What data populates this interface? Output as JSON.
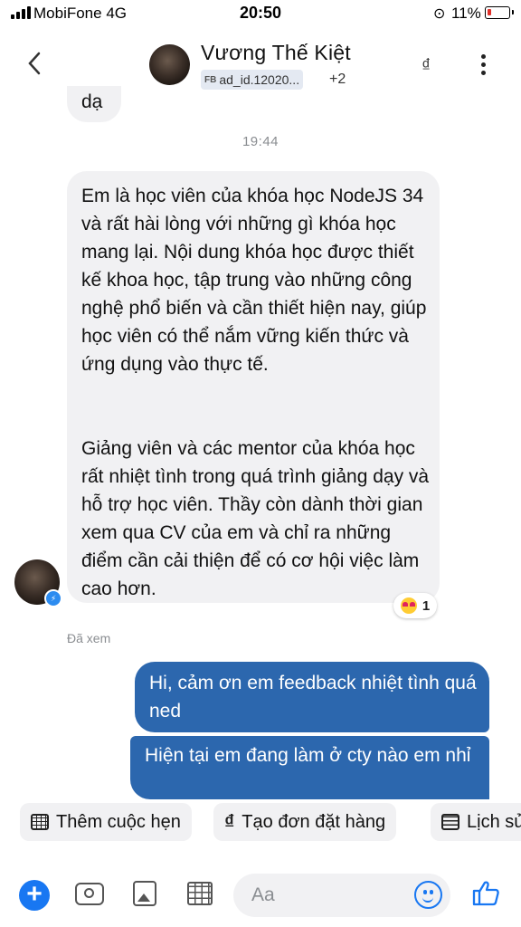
{
  "status_bar": {
    "carrier": "MobiFone  4G",
    "time": "20:50",
    "battery_percent": "11%"
  },
  "header": {
    "back_icon": "chevron-left-icon",
    "name": "Vương Thế Kiệt",
    "tag_prefix": "FB",
    "tag": "ad_id.12020...",
    "tag_more": "+2",
    "currency_icon": "₫",
    "more_icon": "vertical-ellipsis-icon"
  },
  "conversation": {
    "previous_message": "dạ",
    "timestamp": "19:44",
    "incoming": {
      "paragraph1": "Em là học viên của khóa học NodeJS 34 và rất hài lòng với những gì khóa học mang lại. Nội dung khóa học được thiết kế khoa học, tập trung vào những công nghệ phổ biến và cần thiết hiện nay, giúp học viên có thể nắm vững kiến thức và ứng dụng vào thực tế.",
      "paragraph2": "Giảng viên và các mentor của khóa học rất nhiệt tình trong quá trình giảng dạy và hỗ trợ học viên. Thầy còn dành thời gian xem qua CV của em và chỉ ra những điểm cần cải thiện để có cơ hội việc làm cao hơn.",
      "reaction_count": "1"
    },
    "seen_label": "Đã xem",
    "outgoing": [
      "Hi, cảm ơn em feedback nhiệt tình quá ned",
      "Hiện tại em đang làm ở cty nào em nhỉ"
    ]
  },
  "quick_actions": {
    "add_appointment": "Thêm cuộc hẹn",
    "create_order": "Tạo đơn đặt hàng",
    "history": "Lịch sử"
  },
  "composer": {
    "placeholder": "Aa"
  },
  "colors": {
    "outgoing_bubble": "#2c67ae",
    "incoming_bubble": "#f1f1f3",
    "accent": "#1877f2"
  }
}
